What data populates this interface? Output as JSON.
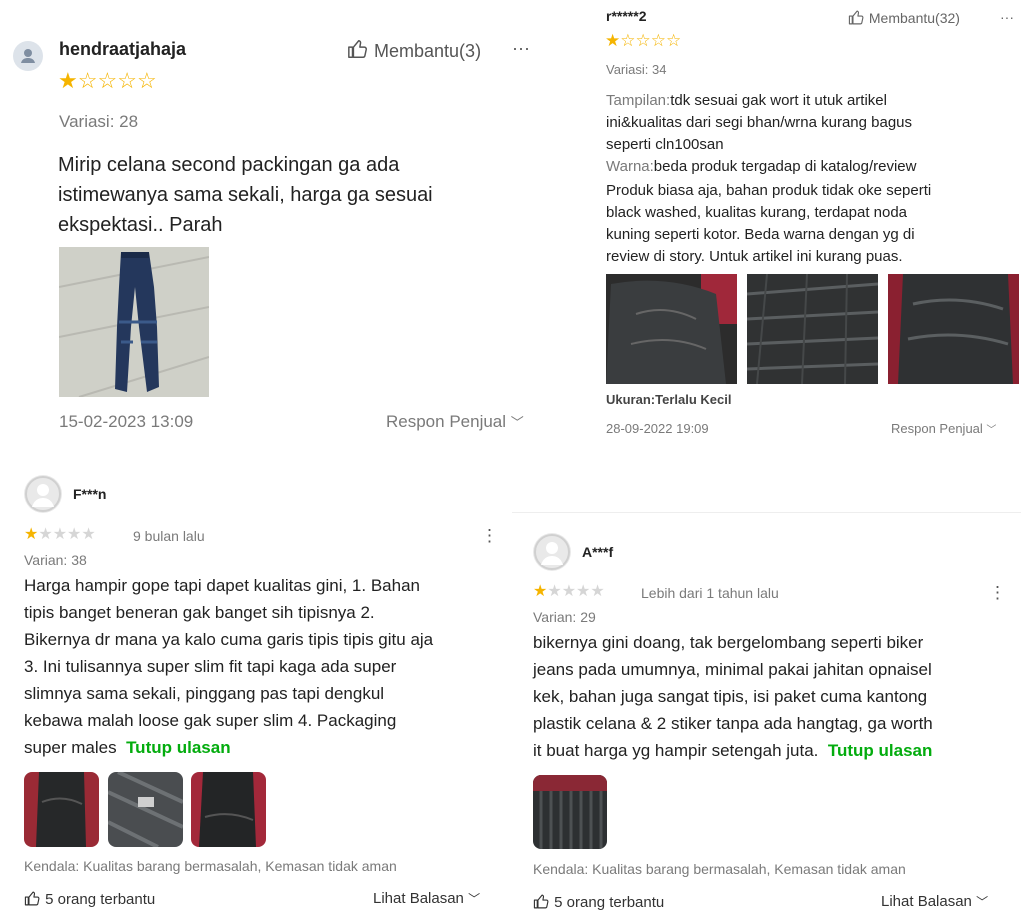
{
  "review1": {
    "username": "hendraatjahaja",
    "helpful_label": "Membantu(3)",
    "more_label": "···",
    "rating": 1,
    "variation": "Variasi: 28",
    "text": [
      "Mirip celana second packingan ga ada",
      "istimewanya sama sekali, harga ga sesuai",
      "ekspektasi.. Parah"
    ],
    "date": "15-02-2023 13:09",
    "seller_response": "Respon Penjual"
  },
  "review2": {
    "username": "r*****2",
    "helpful_label": "Membantu(32)",
    "more_label": "···",
    "rating": 1,
    "variation": "Variasi: 34",
    "tampilan_label": "Tampilan:",
    "tampilan_lines": [
      "tdk sesuai gak wort it utuk artikel",
      "ini&kualitas dari segi bhan/wrna kurang bagus",
      "seperti cln100san"
    ],
    "warna_label": "Warna:",
    "warna_text": "beda produk tergadap di katalog/review",
    "text": [
      "Produk biasa aja, bahan produk tidak oke seperti",
      "black washed, kualitas kurang, terdapat noda",
      "kuning seperti kotor. Beda warna dengan yg di",
      "review di story. Untuk artikel ini kurang puas."
    ],
    "size": "Ukuran:Terlalu Kecil",
    "date": "28-09-2022 19:09",
    "seller_response": "Respon Penjual"
  },
  "review3": {
    "username": "F***n",
    "rating": 1,
    "time_ago": "9 bulan lalu",
    "more_label": "⋮",
    "variation": "Varian: 38",
    "text": [
      "Harga hampir gope tapi dapet kualitas gini, 1. Bahan",
      "tipis banget beneran gak banget sih tipisnya 2.",
      "Bikernya dr mana ya kalo cuma garis tipis tipis gitu aja",
      "3. Ini tulisannya super slim fit tapi kaga ada super",
      "slimnya sama sekali, pinggang pas tapi dengkul",
      "kebawa malah loose gak super slim 4. Packaging",
      "super males"
    ],
    "close_review": "Tutup ulasan",
    "issues": "Kendala: Kualitas barang bermasalah, Kemasan tidak aman",
    "helpful": "5 orang terbantu",
    "view_replies": "Lihat Balasan"
  },
  "review4": {
    "username": "A***f",
    "rating": 1,
    "time_ago": "Lebih dari 1 tahun lalu",
    "more_label": "⋮",
    "variation": "Varian: 29",
    "text": [
      "bikernya gini doang, tak bergelombang seperti biker",
      "jeans pada umumnya, minimal pakai jahitan opnaisel",
      "kek, bahan juga sangat tipis, isi paket cuma kantong",
      "plastik celana & 2 stiker tanpa ada hangtag, ga worth",
      "it buat harga yg hampir setengah juta."
    ],
    "close_review": "Tutup ulasan",
    "issues": "Kendala: Kualitas barang bermasalah, Kemasan tidak aman",
    "helpful": "5 orang terbantu",
    "view_replies": "Lihat Balasan"
  },
  "colors": {
    "star": "#f5b400",
    "green_link": "#03ac0e",
    "grey_text": "#7a7a7a"
  }
}
